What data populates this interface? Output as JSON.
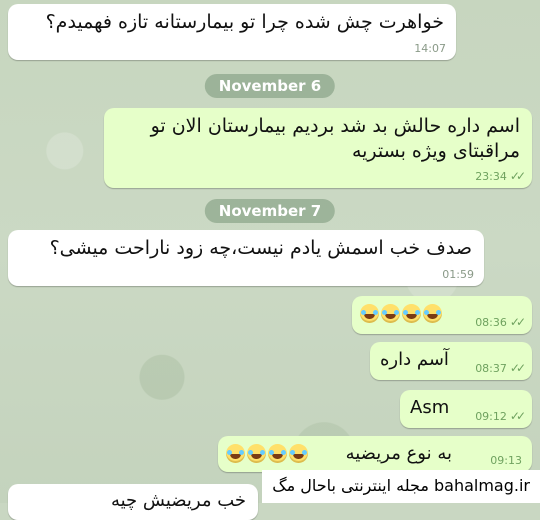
{
  "conversation": {
    "date_separators": [
      "November 6",
      "November 7"
    ],
    "messages": [
      {
        "side": "in",
        "text": "خواهرت چش شده چرا تو بیمارستانه تازه فهمیدم؟",
        "time": "14:07"
      },
      {
        "side": "out",
        "text": "اسم داره  حالش بد شد بردیم بیمارستان الان تو\nمراقبتای ویژه بستریه",
        "time": "23:34"
      },
      {
        "side": "in",
        "text": "صدف خب اسمش یادم نیست،چه زود ناراحت میشی؟",
        "time": "01:59"
      },
      {
        "side": "out",
        "text": "",
        "emoji_count": 4,
        "time": "08:36"
      },
      {
        "side": "out",
        "text": "آسم داره",
        "time": "08:37"
      },
      {
        "side": "out",
        "text": "Asm",
        "time": "09:12"
      },
      {
        "side": "out",
        "text": "به نوع مریضیه",
        "emoji_count": 4,
        "time": "09:13"
      },
      {
        "side": "in",
        "text": "خب مریضیش چیه"
      }
    ]
  },
  "watermark": {
    "text": "مجله اینترنتی باحال مگ bahalmag.ir"
  },
  "colors": {
    "incoming": "#ffffff",
    "outgoing": "#e6ffc9",
    "wallpaper": "#c9d7c2",
    "check": "#6fa25f"
  },
  "icons": {
    "read_receipt": "double-check-icon",
    "emoji": "tears-of-joy-emoji"
  }
}
